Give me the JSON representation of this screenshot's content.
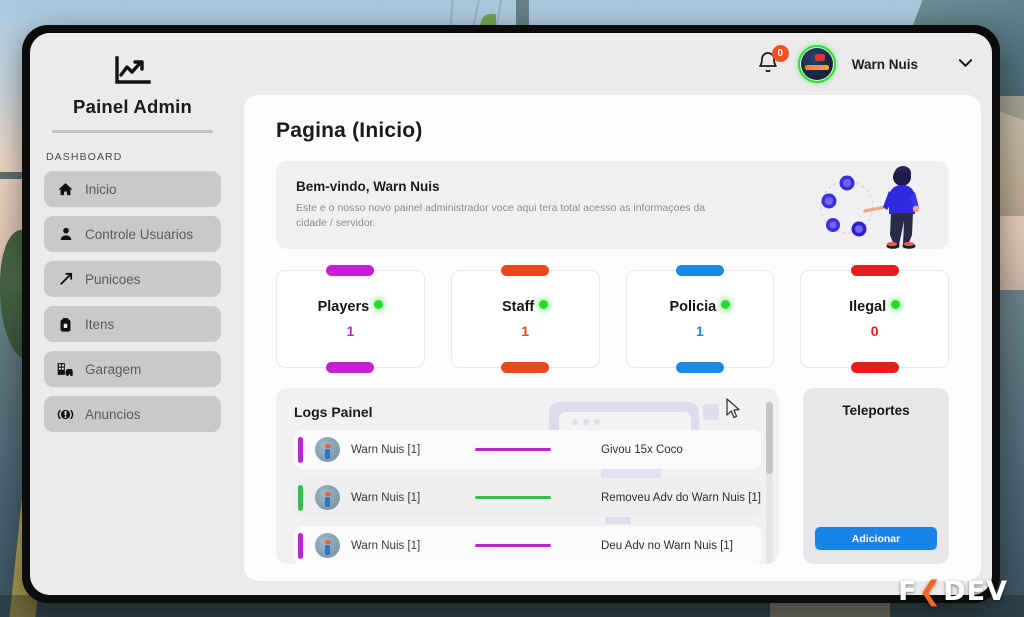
{
  "sidebar": {
    "brand_title": "Painel Admin",
    "brand_icon": "chart-growth-icon",
    "section_label": "DASHBOARD",
    "items": [
      {
        "label": "Inicio",
        "icon": "home-icon"
      },
      {
        "label": "Controle Usuarios",
        "icon": "user-icon"
      },
      {
        "label": "Punicoes",
        "icon": "hammer-icon"
      },
      {
        "label": "Itens",
        "icon": "backpack-icon"
      },
      {
        "label": "Garagem",
        "icon": "garage-car-icon"
      },
      {
        "label": "Anuncios",
        "icon": "megaphone-icon"
      }
    ]
  },
  "topbar": {
    "notification_icon": "bell-icon",
    "notification_count": "0",
    "notification_badge_color": "#f4511e",
    "avatar_name": "avatar",
    "avatar_ring_color": "#22e02a",
    "username": "Warn Nuis",
    "dropdown_icon": "chevron-down-icon"
  },
  "main": {
    "page_title": "Pagina (Inicio)",
    "welcome": {
      "title": "Bem-vindo, Warn Nuis",
      "subtitle": "Este e o nosso novo painel administrador voce aqui tera total acesso as informaçoes da cidade / servidor.",
      "illustration": "person-with-network-illustration"
    },
    "stats": [
      {
        "name": "Players",
        "value": "1",
        "color": "#c91fd4",
        "status_color": "#24dd2a"
      },
      {
        "name": "Staff",
        "value": "1",
        "color": "#e8491b",
        "status_color": "#24dd2a"
      },
      {
        "name": "Policia",
        "value": "1",
        "color": "#1a8ae5",
        "status_color": "#24dd2a"
      },
      {
        "name": "Ilegal",
        "value": "0",
        "color": "#e81c1c",
        "status_color": "#24dd2a"
      }
    ],
    "logs": {
      "title": "Logs Painel",
      "rows": [
        {
          "user": "Warn Nuis [1]",
          "text": "Givou 15x Coco",
          "color": "#c020d8"
        },
        {
          "user": "Warn Nuis [1]",
          "text": "Removeu Adv do Warn Nuis [1]",
          "color": "#2ec44a"
        },
        {
          "user": "Warn Nuis [1]",
          "text": "Deu Adv no Warn Nuis [1]",
          "color": "#c020d8"
        }
      ]
    },
    "teleportes": {
      "title": "Teleportes",
      "button_label": "Adicionar",
      "button_color": "#1884e8"
    }
  },
  "watermark": {
    "text_left": "F",
    "chevron": "❮",
    "text_right": "DEV",
    "accent_color": "#f26522"
  }
}
